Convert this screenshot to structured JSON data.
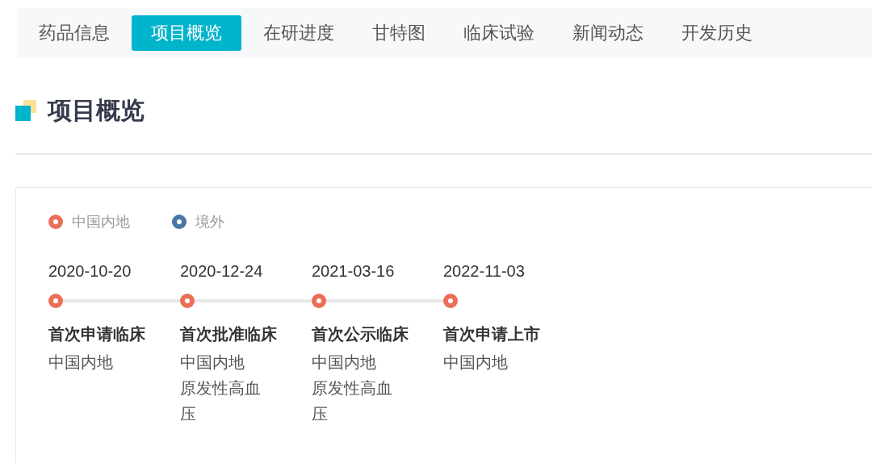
{
  "tabs": [
    {
      "label": "药品信息",
      "selected": false
    },
    {
      "label": "项目概览",
      "selected": true
    },
    {
      "label": "在研进度",
      "selected": false
    },
    {
      "label": "甘特图",
      "selected": false
    },
    {
      "label": "临床试验",
      "selected": false
    },
    {
      "label": "新闻动态",
      "selected": false
    },
    {
      "label": "开发历史",
      "selected": false
    }
  ],
  "section": {
    "title": "项目概览"
  },
  "legend": [
    {
      "label": "中国内地",
      "color": "#eb6e57"
    },
    {
      "label": "境外",
      "color": "#4b76a3"
    }
  ],
  "timeline": [
    {
      "date": "2020-10-20",
      "color": "#eb6e57",
      "event": "首次申请临床",
      "region": "中国内地"
    },
    {
      "date": "2020-12-24",
      "color": "#eb6e57",
      "event": "首次批准临床",
      "region": "中国内地",
      "indication": "原发性高血压"
    },
    {
      "date": "2021-03-16",
      "color": "#eb6e57",
      "event": "首次公示临床",
      "region": "中国内地",
      "indication": "原发性高血压"
    },
    {
      "date": "2022-11-03",
      "color": "#eb6e57",
      "event": "首次申请上市",
      "region": "中国内地"
    }
  ]
}
